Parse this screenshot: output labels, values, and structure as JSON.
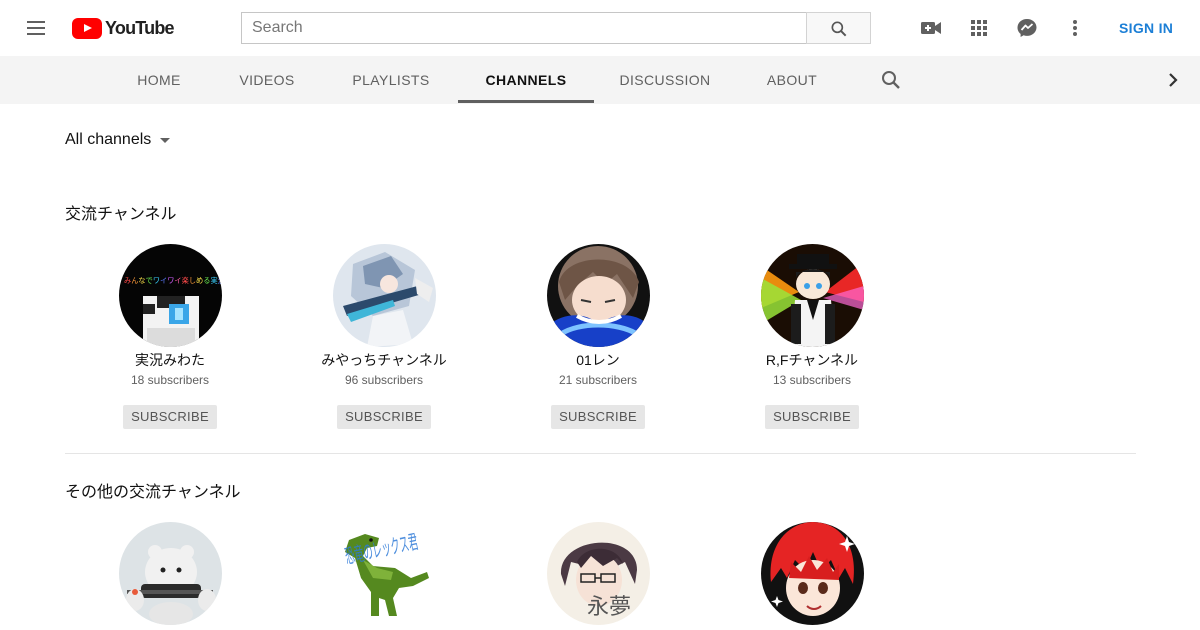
{
  "masthead": {
    "logo_text": "YouTube",
    "search": {
      "placeholder": "Search",
      "value": ""
    },
    "icons": [
      "menu-icon",
      "search-icon",
      "video-camera-icon",
      "apps-grid-icon",
      "messages-icon",
      "more-vert-icon"
    ],
    "sign_in_label": "SIGN IN"
  },
  "tabs": [
    {
      "label": "HOME",
      "active": false
    },
    {
      "label": "VIDEOS",
      "active": false
    },
    {
      "label": "PLAYLISTS",
      "active": false
    },
    {
      "label": "CHANNELS",
      "active": true
    },
    {
      "label": "DISCUSSION",
      "active": false
    },
    {
      "label": "ABOUT",
      "active": false
    }
  ],
  "filter": {
    "label": "All channels"
  },
  "sections": [
    {
      "title": "交流チャンネル",
      "channels": [
        {
          "name": "実況みわた",
          "subscribers": "18 subscribers",
          "button": "SUBSCRIBE"
        },
        {
          "name": "みやっちチャンネル",
          "subscribers": "96 subscribers",
          "button": "SUBSCRIBE"
        },
        {
          "name": "01レン",
          "subscribers": "21 subscribers",
          "button": "SUBSCRIBE"
        },
        {
          "name": "R,Fチャンネル",
          "subscribers": "13 subscribers",
          "button": "SUBSCRIBE"
        }
      ]
    },
    {
      "title": "その他の交流チャンネル",
      "avatar_text": {
        "card2": "恐竜のレックス君",
        "card3": "永夢"
      }
    }
  ],
  "avatar_banner_text": "みんなでワイワイ楽しめる実況",
  "colors": {
    "brand_red": "#ff0000",
    "sign_in_blue": "#1c7fd6",
    "tab_bar_bg": "#f4f4f4"
  }
}
